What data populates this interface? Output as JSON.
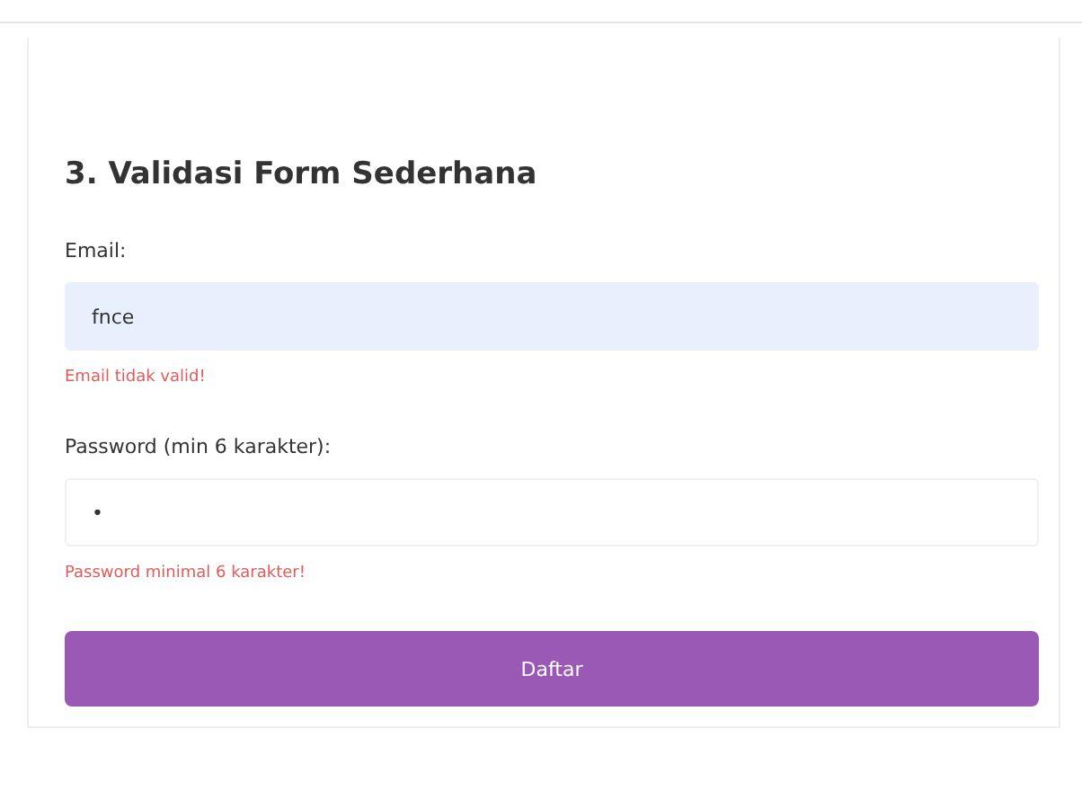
{
  "form": {
    "title": "3. Validasi Form Sederhana",
    "fields": [
      {
        "label": "Email:",
        "value": "fnce",
        "error": "Email tidak valid!",
        "autofilled": true
      },
      {
        "label": "Password (min 6 karakter):",
        "value": "•",
        "error": "Password minimal 6 karakter!",
        "autofilled": false
      }
    ],
    "submit": "Daftar"
  }
}
